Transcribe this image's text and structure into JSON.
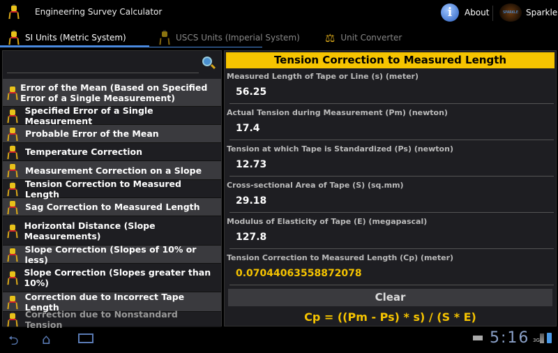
{
  "app": {
    "title": "Engineering Survey Calculator",
    "about": "About",
    "sparkle": "Sparkle",
    "sparkle_logo": "SPARKLE"
  },
  "tabs": [
    {
      "label": "SI Units (Metric System)",
      "active": true
    },
    {
      "label": "USCS Units (Imperial System)"
    },
    {
      "label": "Unit Converter"
    }
  ],
  "search": {
    "placeholder": "",
    "value": ""
  },
  "list": [
    "Error of the Mean (Based on Specified Error of a Single Measurement)",
    "Specified Error of a Single Measurement",
    "Probable Error of the Mean",
    "Temperature Correction",
    "Measurement Correction on a Slope",
    "Tension Correction to Measured Length",
    "Sag Correction to Measured Length",
    "Horizontal Distance (Slope Measurements)",
    "Slope Correction (Slopes of 10% or less)",
    "Slope Correction (Slopes greater than 10%)",
    "Correction due to Incorrect Tape Length",
    "Correction due to Nonstandard Tension"
  ],
  "form": {
    "title": "Tension Correction to Measured Length",
    "fields": [
      {
        "label": "Measured Length of Tape or Line (s) (meter)",
        "value": "56.25"
      },
      {
        "label": "Actual Tension during Measurement (Pm) (newton)",
        "value": "17.4"
      },
      {
        "label": "Tension at which Tape is Standardized (Ps) (newton)",
        "value": "12.73"
      },
      {
        "label": "Cross-sectional Area of Tape (S) (sq.mm)",
        "value": "29.18"
      },
      {
        "label": "Modulus of Elasticity of Tape (E) (megapascal)",
        "value": "127.8"
      }
    ],
    "result": {
      "label": "Tension Correction to Measured Length (Cp) (meter)",
      "value": "0.07044063558872078"
    },
    "clear": "Clear",
    "formula": "Cp = ((Pm - Ps) * s) / (S * E)"
  },
  "status": {
    "time": "5:16",
    "network": "3G"
  },
  "colors": {
    "accent": "#f6c400",
    "tab_indicator": "#3a7bd5"
  }
}
